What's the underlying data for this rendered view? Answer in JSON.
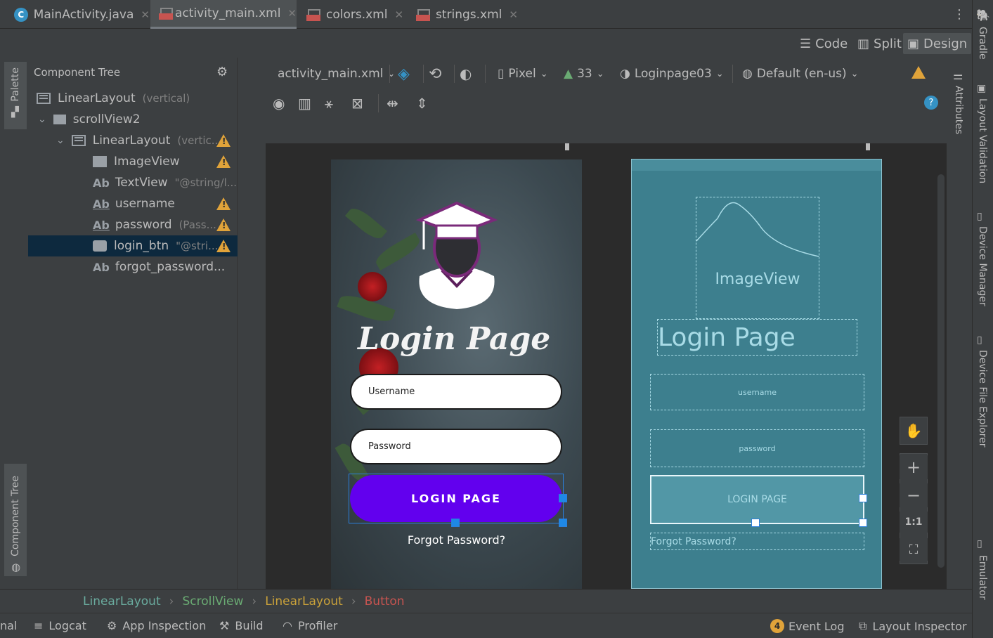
{
  "tabs": [
    {
      "label": "MainActivity.java",
      "icon": "java-class-icon"
    },
    {
      "label": "activity_main.xml",
      "icon": "layout-xml-icon",
      "active": true
    },
    {
      "label": "colors.xml",
      "icon": "values-xml-icon"
    },
    {
      "label": "strings.xml",
      "icon": "values-xml-icon"
    }
  ],
  "modes": {
    "code": "Code",
    "split": "Split",
    "design": "Design",
    "active": "Design"
  },
  "left_strip": {
    "palette": "Palette",
    "component_tree": "Component Tree"
  },
  "tree": {
    "title": "Component Tree",
    "rows": [
      {
        "icon": "linear-layout-icon",
        "label": "LinearLayout",
        "hint": "(vertical)",
        "warn": false
      },
      {
        "icon": "scrollview-icon",
        "label": "scrollView2",
        "hint": "",
        "warn": false
      },
      {
        "icon": "linear-layout-icon",
        "label": "LinearLayout",
        "hint": "(vertic...",
        "warn": true
      },
      {
        "icon": "imageview-icon",
        "label": "ImageView",
        "hint": "",
        "warn": true
      },
      {
        "icon": "textview-icon",
        "label": "TextView",
        "hint": "\"@string/l...",
        "warn": false
      },
      {
        "icon": "edittext-icon",
        "label": "username",
        "hint": "",
        "warn": true
      },
      {
        "icon": "edittext-icon",
        "label": "password",
        "hint": "(Pass...",
        "warn": true
      },
      {
        "icon": "button-icon",
        "label": "login_btn",
        "hint": "\"@stri...",
        "warn": true,
        "selected": true
      },
      {
        "icon": "textview-icon",
        "label": "forgot_password...",
        "hint": "",
        "warn": false
      }
    ]
  },
  "design_toolbar": {
    "file": "activity_main.xml",
    "device": "Pixel",
    "api": "33",
    "theme": "Loginpage03",
    "locale": "Default (en-us)"
  },
  "phone": {
    "title": "Login Page",
    "username_hint": "Username",
    "password_hint": "Password",
    "button": "LOGIN PAGE",
    "forgot": "Forgot Password?",
    "button_color": "#6200ee"
  },
  "blueprint": {
    "imageview": "ImageView",
    "title": "Login Page",
    "username": "username",
    "password": "password",
    "button": "LOGIN PAGE",
    "forgot": "Forgot Password?"
  },
  "zoom": {
    "one_to_one": "1:1"
  },
  "right_strip": {
    "attributes": "Attributes"
  },
  "far_right": {
    "gradle": "Gradle",
    "layout_validation": "Layout Validation",
    "device_manager": "Device Manager",
    "device_file_explorer": "Device File Explorer",
    "emulator": "Emulator"
  },
  "breadcrumb": [
    "LinearLayout",
    "ScrollView",
    "LinearLayout",
    "Button"
  ],
  "bottom": {
    "terminal": "nal",
    "logcat": "Logcat",
    "app_inspection": "App Inspection",
    "build": "Build",
    "profiler": "Profiler",
    "event_log": "Event Log",
    "event_count": "4",
    "layout_inspector": "Layout Inspector"
  }
}
